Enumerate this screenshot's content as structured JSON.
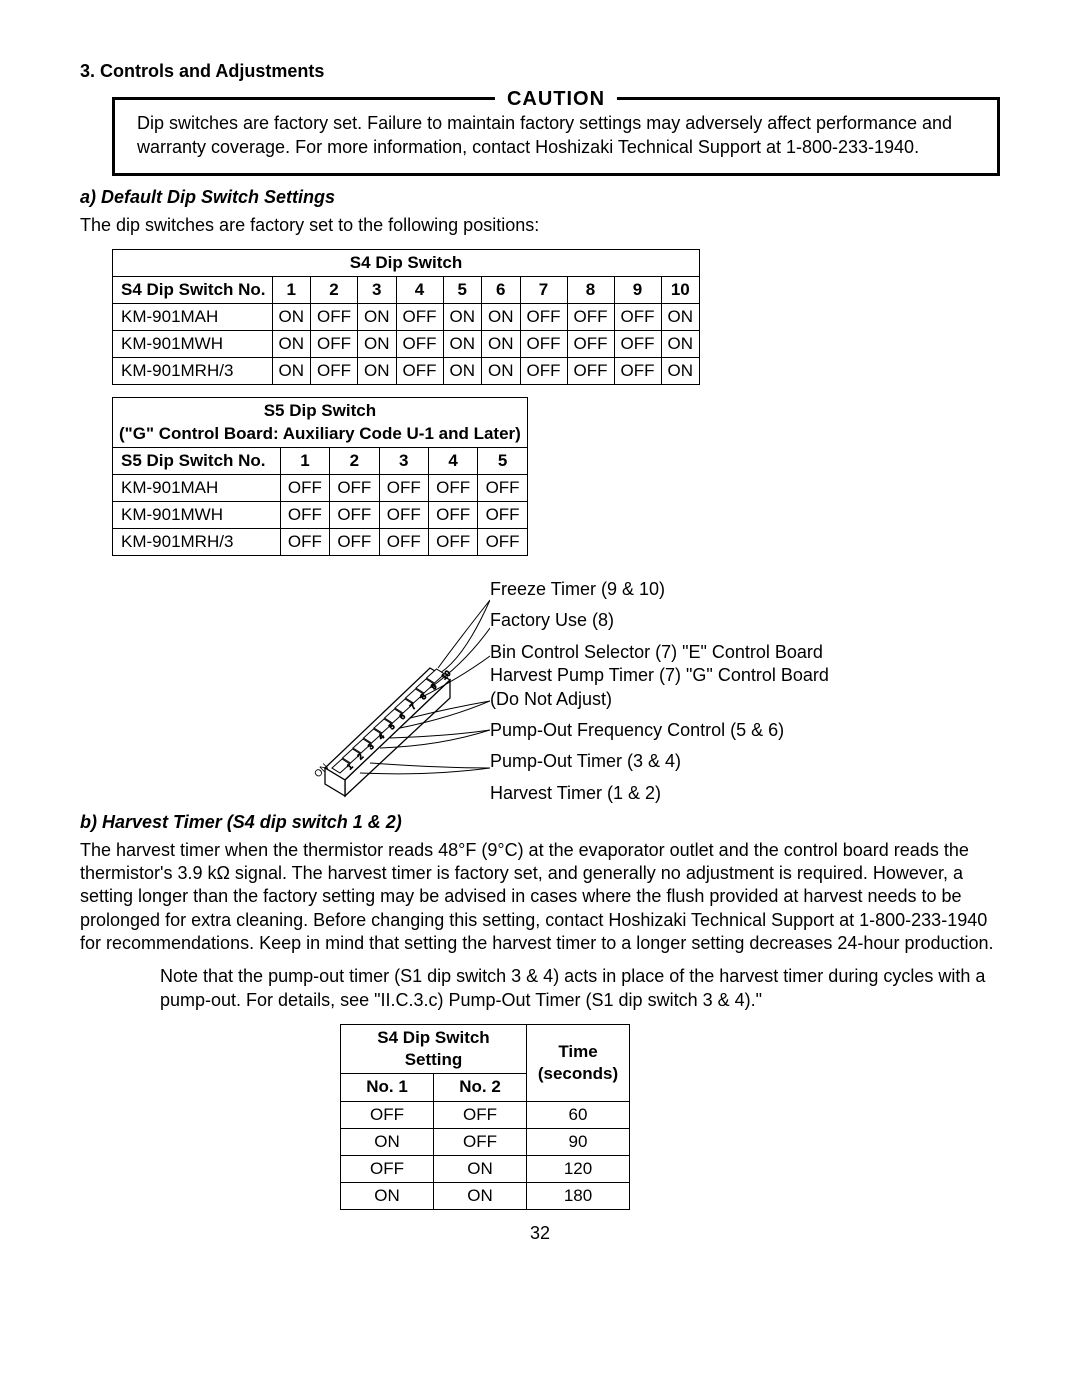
{
  "section_title": "3. Controls and Adjustments",
  "caution": {
    "heading": "CAUTION",
    "body": "Dip switches are factory set. Failure to maintain factory settings may adversely affect performance and warranty coverage. For more information, contact Hoshizaki Technical Support at 1-800-233-1940."
  },
  "sub_a": {
    "heading": "a) Default Dip Switch Settings",
    "intro": "The dip switches are factory set to the following positions:"
  },
  "s4_table": {
    "title": "S4 Dip Switch",
    "row_header": "S4 Dip Switch No.",
    "cols": [
      "1",
      "2",
      "3",
      "4",
      "5",
      "6",
      "7",
      "8",
      "9",
      "10"
    ],
    "rows": [
      {
        "model": "KM-901MAH",
        "vals": [
          "ON",
          "OFF",
          "ON",
          "OFF",
          "ON",
          "ON",
          "OFF",
          "OFF",
          "OFF",
          "ON"
        ]
      },
      {
        "model": "KM-901MWH",
        "vals": [
          "ON",
          "OFF",
          "ON",
          "OFF",
          "ON",
          "ON",
          "OFF",
          "OFF",
          "OFF",
          "ON"
        ]
      },
      {
        "model": "KM-901MRH/3",
        "vals": [
          "ON",
          "OFF",
          "ON",
          "OFF",
          "ON",
          "ON",
          "OFF",
          "OFF",
          "OFF",
          "ON"
        ]
      }
    ]
  },
  "s5_table": {
    "title_line1": "S5 Dip Switch",
    "title_line2": "(\"G\" Control Board: Auxiliary Code U-1 and Later)",
    "row_header": "S5 Dip Switch No.",
    "cols": [
      "1",
      "2",
      "3",
      "4",
      "5"
    ],
    "rows": [
      {
        "model": "KM-901MAH",
        "vals": [
          "OFF",
          "OFF",
          "OFF",
          "OFF",
          "OFF"
        ]
      },
      {
        "model": "KM-901MWH",
        "vals": [
          "OFF",
          "OFF",
          "OFF",
          "OFF",
          "OFF"
        ]
      },
      {
        "model": "KM-901MRH/3",
        "vals": [
          "OFF",
          "OFF",
          "OFF",
          "OFF",
          "OFF"
        ]
      }
    ]
  },
  "diagram_labels": {
    "l1": "Freeze Timer (9 & 10)",
    "l2": "Factory Use (8)",
    "l3a": "Bin Control Selector (7) \"E\" Control Board",
    "l3b": "Harvest Pump Timer (7) \"G\" Control Board",
    "l3c": "(Do Not Adjust)",
    "l4": "Pump-Out Frequency Control (5 & 6)",
    "l5": "Pump-Out Timer (3 & 4)",
    "l6": "Harvest Timer (1 & 2)",
    "on": "ON",
    "nums": [
      "1",
      "2",
      "3",
      "4",
      "5",
      "6",
      "7",
      "8",
      "9",
      "10"
    ]
  },
  "sub_b": {
    "heading": "b) Harvest Timer (S4 dip switch 1 & 2)",
    "para": "The harvest timer when the thermistor reads 48°F (9°C) at the evaporator outlet and the control board reads the thermistor's 3.9 kΩ signal. The harvest timer is factory set, and generally no adjustment is required. However, a setting longer than the factory setting may be advised in cases where the flush provided at harvest needs to be prolonged for extra cleaning. Before changing this setting, contact Hoshizaki Technical Support at 1-800-233-1940 for recommendations. Keep in mind that setting the harvest timer to a longer setting decreases 24-hour production.",
    "note": "Note that the pump-out timer (S1 dip switch 3 & 4) acts in place of the harvest timer during cycles with a pump-out. For details, see \"II.C.3.c) Pump-Out Timer (S1 dip switch 3 & 4).\""
  },
  "timer_table": {
    "h_setting": "S4 Dip Switch Setting",
    "h_time": "Time (seconds)",
    "h_no1": "No. 1",
    "h_no2": "No. 2",
    "rows": [
      {
        "a": "OFF",
        "b": "OFF",
        "t": "60"
      },
      {
        "a": "ON",
        "b": "OFF",
        "t": "90"
      },
      {
        "a": "OFF",
        "b": "ON",
        "t": "120"
      },
      {
        "a": "ON",
        "b": "ON",
        "t": "180"
      }
    ]
  },
  "page_number": "32"
}
